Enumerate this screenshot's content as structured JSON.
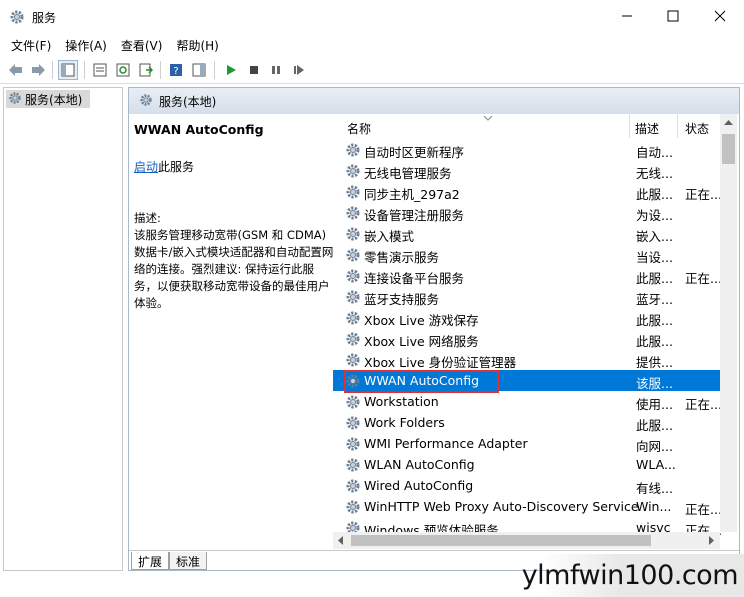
{
  "window": {
    "title": "服务"
  },
  "menu": [
    "文件(F)",
    "操作(A)",
    "查看(V)",
    "帮助(H)"
  ],
  "tree": {
    "label": "服务(本地)"
  },
  "panel": {
    "header": "服务(本地)"
  },
  "details": {
    "service_name": "WWAN AutoConfig",
    "start_link": "启动",
    "start_suffix": "此服务",
    "desc_label": "描述:",
    "desc_text": "该服务管理移动宽带(GSM 和 CDMA)数据卡/嵌入式模块适配器和自动配置网络的连接。强烈建议: 保持运行此服务，以便获取移动宽带设备的最佳用户体验。"
  },
  "columns": {
    "name": "名称",
    "desc": "描述",
    "status": "状态"
  },
  "rows": [
    {
      "name": "自动时区更新程序",
      "desc": "自动...",
      "status": ""
    },
    {
      "name": "无线电管理服务",
      "desc": "无线...",
      "status": ""
    },
    {
      "name": "同步主机_297a2",
      "desc": "此服...",
      "status": "正在..."
    },
    {
      "name": "设备管理注册服务",
      "desc": "为设...",
      "status": ""
    },
    {
      "name": "嵌入模式",
      "desc": "嵌入...",
      "status": ""
    },
    {
      "name": "零售演示服务",
      "desc": "当设...",
      "status": ""
    },
    {
      "name": "连接设备平台服务",
      "desc": "此服...",
      "status": "正在..."
    },
    {
      "name": "蓝牙支持服务",
      "desc": "蓝牙...",
      "status": ""
    },
    {
      "name": "Xbox Live 游戏保存",
      "desc": "此服...",
      "status": ""
    },
    {
      "name": "Xbox Live 网络服务",
      "desc": "此服...",
      "status": ""
    },
    {
      "name": "Xbox Live 身份验证管理器",
      "desc": "提供...",
      "status": ""
    },
    {
      "name": "WWAN AutoConfig",
      "desc": "该服...",
      "status": "",
      "selected": true
    },
    {
      "name": "Workstation",
      "desc": "使用...",
      "status": "正在..."
    },
    {
      "name": "Work Folders",
      "desc": "此服...",
      "status": ""
    },
    {
      "name": "WMI Performance Adapter",
      "desc": "向网...",
      "status": ""
    },
    {
      "name": "WLAN AutoConfig",
      "desc": "WLA...",
      "status": ""
    },
    {
      "name": "Wired AutoConfig",
      "desc": "有线...",
      "status": ""
    },
    {
      "name": "WinHTTP Web Proxy Auto-Discovery Service",
      "desc": "Win...",
      "status": "正在..."
    },
    {
      "name": "Windows 预览体验服务",
      "desc": "wisvc",
      "status": "正在..."
    }
  ],
  "tabs": [
    "扩展",
    "标准"
  ],
  "watermark": "ylmfwin100.com",
  "colors": {
    "selection": "#0078d7",
    "highlight_box": "#e03030",
    "link": "#1560bd"
  }
}
